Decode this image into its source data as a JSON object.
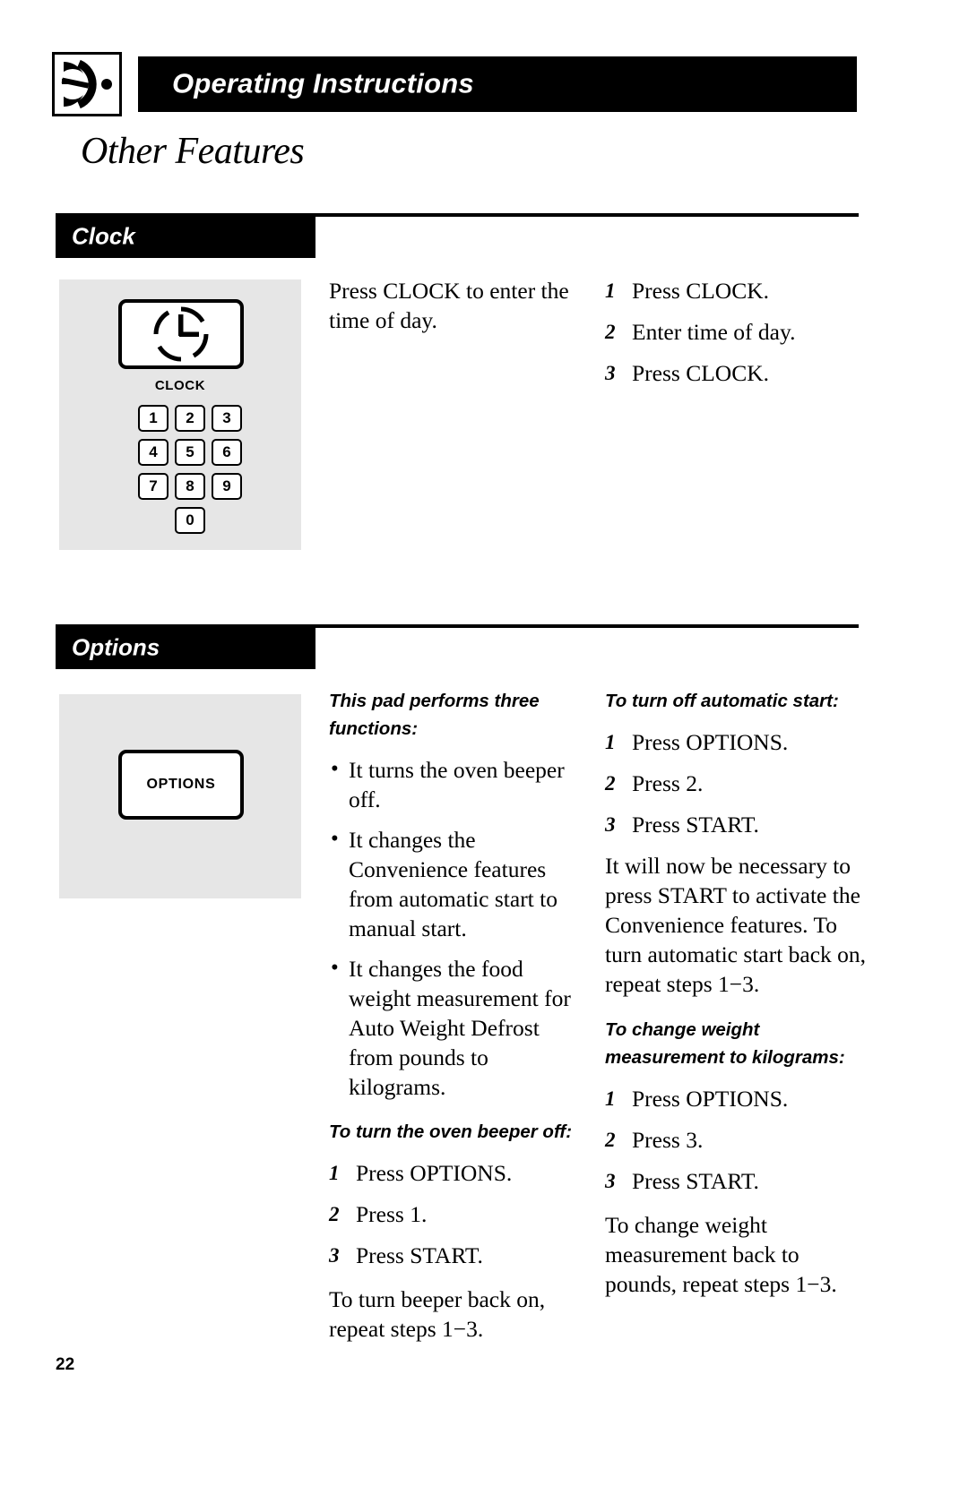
{
  "header": {
    "title": "Operating Instructions",
    "logo_icon": "microwave-dial-icon"
  },
  "page_title": "Other Features",
  "page_number": "22",
  "sections": [
    {
      "id": "clock",
      "tab_label": "Clock",
      "panel": {
        "button_icon": "clock-face-icon",
        "button_label": "CLOCK",
        "keypad": [
          "1",
          "2",
          "3",
          "4",
          "5",
          "6",
          "7",
          "8",
          "9",
          "0"
        ]
      },
      "middle_column": {
        "paragraphs": [
          "Press CLOCK to enter the time of day."
        ]
      },
      "right_column": {
        "steps": [
          {
            "num": "1",
            "text": "Press CLOCK."
          },
          {
            "num": "2",
            "text": "Enter time of day."
          },
          {
            "num": "3",
            "text": "Press CLOCK."
          }
        ]
      }
    },
    {
      "id": "options",
      "tab_label": "Options",
      "panel": {
        "button_label": "OPTIONS"
      },
      "middle_column": {
        "intro_heading": "This pad performs three functions:",
        "bullets": [
          "It turns the oven beeper off.",
          "It changes the Convenience features from automatic start to manual start.",
          "It changes the food weight measurement for Auto Weight Defrost from pounds to kilograms."
        ],
        "beeper_heading": "To turn the oven beeper off:",
        "beeper_steps": [
          {
            "num": "1",
            "text": "Press OPTIONS."
          },
          {
            "num": "2",
            "text": "Press 1."
          },
          {
            "num": "3",
            "text": "Press START."
          }
        ],
        "beeper_note": "To turn beeper back on, repeat steps 1−3."
      },
      "right_column": {
        "auto_start_heading": "To turn off automatic start:",
        "auto_start_steps": [
          {
            "num": "1",
            "text": "Press OPTIONS."
          },
          {
            "num": "2",
            "text": "Press 2."
          },
          {
            "num": "3",
            "text": "Press START."
          }
        ],
        "auto_start_note": "It will now be necessary to press START to activate the Convenience features. To turn automatic start back on, repeat steps 1−3.",
        "kilograms_heading": "To change weight measurement to kilograms:",
        "kilograms_steps": [
          {
            "num": "1",
            "text": "Press OPTIONS."
          },
          {
            "num": "2",
            "text": "Press 3."
          },
          {
            "num": "3",
            "text": "Press START."
          }
        ],
        "kilograms_note": "To change weight measurement back to pounds, repeat steps 1−3."
      }
    }
  ]
}
